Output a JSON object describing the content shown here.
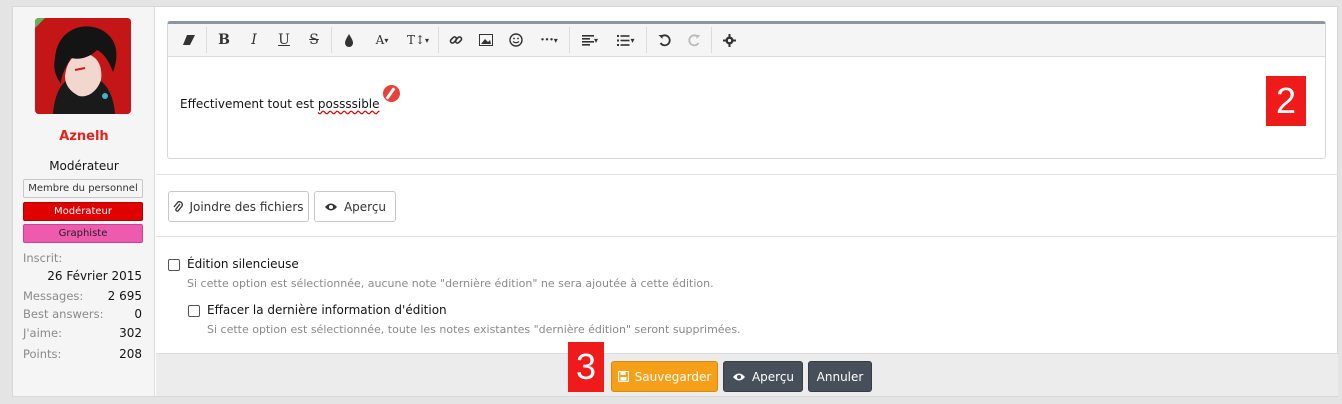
{
  "user": {
    "name": "Aznelh",
    "role": "Modérateur",
    "banners": [
      "Membre du personnel",
      "Modérateur",
      "Graphiste"
    ],
    "stats": [
      {
        "label": "Inscrit:",
        "value": "26 Février 2015"
      },
      {
        "label": "Messages:",
        "value": "2 695"
      },
      {
        "label": "Best answers:",
        "value": "0"
      },
      {
        "label": "J'aime:",
        "value": "302"
      },
      {
        "label": "Points:",
        "value": "208"
      }
    ]
  },
  "editor": {
    "text_prefix": "Effectivement tout est ",
    "text_typo": "possssible",
    "toolbar": {
      "bold": "B",
      "italic": "I",
      "underline": "U",
      "strike": "S",
      "font_color": "A",
      "font_size": "T↕"
    }
  },
  "annotations": {
    "two": "2",
    "three": "3"
  },
  "attach": {
    "attach_label": "Joindre des fichiers",
    "preview_label": "Aperçu"
  },
  "options": {
    "silent_label": "Édition silencieuse",
    "silent_hint": "Si cette option est sélectionnée, aucune note \"dernière édition\" ne sera ajoutée à cette édition.",
    "clear_label": "Effacer la dernière information d'édition",
    "clear_hint": "Si cette option est sélectionnée, toute les notes existantes \"dernière édition\" seront supprimées."
  },
  "footer": {
    "save_label": "Sauvegarder",
    "preview_label": "Aperçu",
    "cancel_label": "Annuler"
  },
  "colors": {
    "accent": "#f6a019",
    "username": "#e3231b",
    "annotation": "#ef1a1a"
  }
}
